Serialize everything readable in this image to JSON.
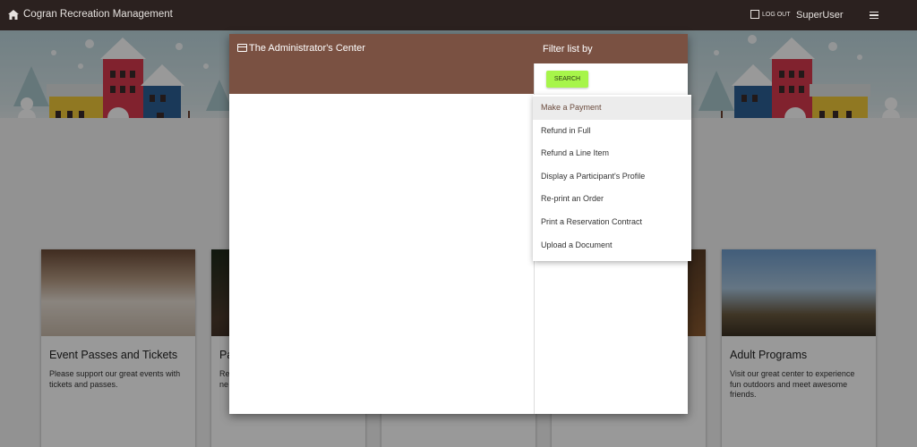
{
  "header": {
    "app_title": "Cogran Recreation Management",
    "logout_label": "LOG OUT",
    "username": "SuperUser"
  },
  "cards": [
    {
      "title": "Event Passes and Tickets",
      "description": "Please support our great events with tickets and passes."
    },
    {
      "title": "Pa",
      "description": "Re ne"
    },
    {
      "title": "",
      "description": ""
    },
    {
      "title": "Adult Programs",
      "description": "Visit our great center to experience fun outdoors and meet awesome friends."
    }
  ],
  "dialog": {
    "title": "The Administrator's Center",
    "filter_label": "Filter list by",
    "search_label": "SEARCH",
    "menu_items": [
      "Make a Payment",
      "Refund in Full",
      "Refund a Line Item",
      "Display a Participant's Profile",
      "Re-print an Order",
      "Print a Reservation Contract",
      "Upload a Document"
    ]
  },
  "colors": {
    "topbar": "#2b211f",
    "dialog_header": "#7a5142",
    "search_button": "#a7f54a"
  }
}
